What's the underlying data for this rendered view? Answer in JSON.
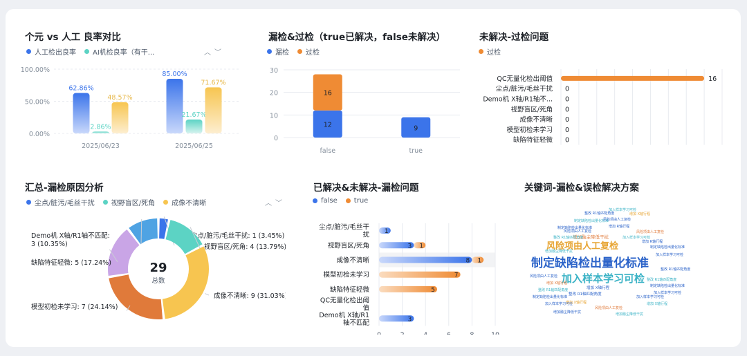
{
  "colors": {
    "blue": "#3b74ea",
    "teal": "#5cd3c4",
    "yellow": "#f7c550",
    "orange": "#ef8b34",
    "purple": "#c9a5e6",
    "deeporange": "#e07a3a",
    "lightblue": "#4fa3e3",
    "grid": "#e8ebf0",
    "axis": "#86909c"
  },
  "panels": {
    "p1": {
      "title": "个元 vs 人工 良率对比",
      "legend": [
        "人工检出良率",
        "AI机检良率（有干..."
      ],
      "icons": [
        "chevron-up-icon",
        "chevron-down-icon"
      ]
    },
    "p2": {
      "title": "漏检&过检（true已解决，false未解决）",
      "legend": [
        "漏检",
        "过检"
      ]
    },
    "p3": {
      "title": "未解决-过检问题",
      "legend": [
        "过检"
      ]
    },
    "p4": {
      "title": "汇总-漏检原因分析",
      "legend": [
        "尘点/脏污/毛丝干扰",
        "视野盲区/死角",
        "成像不清晰"
      ],
      "icons": [
        "chevron-up-icon",
        "chevron-down-icon"
      ]
    },
    "p5": {
      "title": "已解决&未解决-漏检问题",
      "legend": [
        "false",
        "true"
      ]
    },
    "p6": {
      "title": "关键词-漏检&误检解决方案"
    }
  },
  "chart_data": [
    {
      "id": "yield",
      "type": "bar",
      "categories": [
        "2025/06/23",
        "2025/06/25"
      ],
      "series": [
        {
          "name": "人工检出良率",
          "values": [
            62.86,
            85.0
          ],
          "labels": [
            "62.86%",
            "85.00%"
          ]
        },
        {
          "name": "AI机检良率（有干...",
          "values": [
            2.86,
            21.67
          ],
          "labels": [
            "2.86%",
            "21.67%"
          ]
        },
        {
          "name": "",
          "values": [
            48.57,
            71.67
          ],
          "labels": [
            "48.57%",
            "71.67%"
          ]
        }
      ],
      "yticks": [
        "0.00%",
        "50.00%",
        "100.00%"
      ],
      "ylim": [
        0,
        100
      ]
    },
    {
      "id": "miss_over",
      "type": "bar",
      "stacked": true,
      "categories": [
        "false",
        "true"
      ],
      "series": [
        {
          "name": "漏检",
          "values": [
            12,
            9
          ]
        },
        {
          "name": "过检",
          "values": [
            16,
            0
          ]
        }
      ],
      "yticks": [
        "0",
        "10",
        "20",
        "30"
      ],
      "ylim": [
        0,
        30
      ]
    },
    {
      "id": "over_unresolved",
      "type": "bar",
      "orientation": "horizontal",
      "categories": [
        "QC无量化检出阈值",
        "尘点/脏污/毛丝干扰",
        "Demo机 X轴/R1轴不...",
        "视野盲区/死角",
        "成像不清晰",
        "模型初检未学习",
        "缺陷特征轻微"
      ],
      "series": [
        {
          "name": "过检",
          "values": [
            16,
            0,
            0,
            0,
            0,
            0,
            0
          ]
        }
      ],
      "xticks": [
        "0",
        "2",
        "4",
        "6",
        "8",
        "10",
        "12",
        "14",
        "16",
        "18"
      ],
      "xlim": [
        0,
        18
      ]
    },
    {
      "id": "miss_reason",
      "type": "pie",
      "center_value": "29",
      "center_label": "总数",
      "slices": [
        {
          "name": "尘点/脏污/毛丝干扰",
          "value": 1,
          "label": "尘点/脏污/毛丝干扰: 1 (3.45%)"
        },
        {
          "name": "视野盲区/死角",
          "value": 4,
          "label": "视野盲区/死角: 4 (13.79%)"
        },
        {
          "name": "成像不清晰",
          "value": 9,
          "label": "成像不清晰: 9 (31.03%)"
        },
        {
          "name": "模型初检未学习",
          "value": 7,
          "label": "模型初检未学习: 7 (24.14%)"
        },
        {
          "name": "缺陷特征轻微",
          "value": 5,
          "label": "缺陷特征轻微: 5 (17.24%)"
        },
        {
          "name": "Demo机 X轴/R1轴不匹配",
          "value": 3,
          "label": "Demo机 X轴/R1轴不匹配:\n3 (10.35%)"
        }
      ]
    },
    {
      "id": "miss_resolved",
      "type": "bar",
      "orientation": "horizontal",
      "stacked": true,
      "categories": [
        "尘点/脏污/毛丝干\n扰",
        "视野盲区/死角",
        "成像不清晰",
        "模型初检未学习",
        "缺陷特征轻微",
        "QC无量化检出阈\n值",
        "Demo机 X轴/R1\n轴不匹配"
      ],
      "series": [
        {
          "name": "false",
          "values": [
            1,
            3,
            8,
            0,
            0,
            0,
            3
          ]
        },
        {
          "name": "true",
          "values": [
            0,
            1,
            1,
            7,
            5,
            0,
            0
          ]
        }
      ],
      "xticks": [
        "0",
        "2",
        "4",
        "6",
        "8",
        "10"
      ],
      "xlim": [
        0,
        10
      ]
    }
  ],
  "wordcloud": {
    "words": [
      "风险项由人工复检",
      "制定缺陷检出量化标准",
      "加入样本学习可检",
      "增加 X轴行程",
      "整改 R1轴匹配角度",
      "增加融尘降低干扰",
      "增加 R轴行程",
      "制定缺陷检出量化标准",
      "加入样本学习可检",
      "风险项由人工复检",
      "增加 X轴行程",
      "整改 R1轴匹配角度",
      "增加融尘降低干扰",
      "制定缺陷检出量化标准",
      "加入样本学习可检",
      "风险项由人工复检",
      "增加 R轴行程",
      "整改 R1轴匹配角度",
      "制定缺陷检出量化标准",
      "加入样本学习可检",
      "增加 X轴行程",
      "风险项由人工复检",
      "增加融尘降低干扰",
      "整改 R1轴匹配角度",
      "制定缺陷检出量化标准",
      "加入样本学习可检",
      "增加 X轴行程",
      "风险项由人工复检",
      "整改 R1轴匹配角度",
      "加入样本学习可检",
      "增加 X轴行程",
      "制定缺陷检出量化标准",
      "增加融尘降低干扰",
      "风险项由人工复检",
      "整改 R1轴匹配角度",
      "加入样本学习可检"
    ]
  }
}
